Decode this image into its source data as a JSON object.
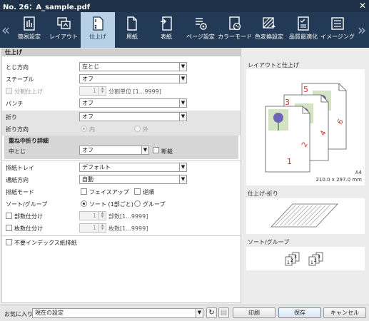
{
  "window": {
    "title": "No. 26：A_sample.pdf",
    "close_label": "✕"
  },
  "tabs": [
    {
      "label": "簡易設定",
      "icon": "simple-settings-icon"
    },
    {
      "label": "レイアウト",
      "icon": "layout-icon"
    },
    {
      "label": "仕上げ",
      "icon": "finishing-icon",
      "active": true
    },
    {
      "label": "用紙",
      "icon": "paper-icon"
    },
    {
      "label": "表紙",
      "icon": "cover-icon"
    },
    {
      "label": "ページ設定",
      "icon": "page-settings-icon"
    },
    {
      "label": "カラーモード",
      "icon": "color-mode-icon"
    },
    {
      "label": "色変換設定",
      "icon": "color-conversion-icon"
    },
    {
      "label": "品質最適化",
      "icon": "quality-icon"
    },
    {
      "label": "イメージング",
      "icon": "imaging-icon"
    }
  ],
  "finishing": {
    "section_title": "仕上げ",
    "binding_direction": {
      "label": "とじ方向",
      "value": "左とじ"
    },
    "staple": {
      "label": "ステープル",
      "value": "オフ"
    },
    "separate": {
      "label": "分割仕上げ",
      "value": "1",
      "unit": "分割単位 [1...9999]"
    },
    "punch": {
      "label": "パンチ",
      "value": "オフ"
    },
    "fold": {
      "label": "折り",
      "value": "オフ"
    },
    "fold_direction": {
      "label": "折り方向",
      "option_in": "内",
      "option_out": "外"
    },
    "saddle_detail": {
      "title": "重ね中折り詳細",
      "label": "中とじ",
      "value": "オフ",
      "trim_label": "断裁"
    }
  },
  "output": {
    "tray": {
      "label": "排紙トレイ",
      "value": "デフォルト"
    },
    "feed_direction": {
      "label": "通紙方向",
      "value": "自動"
    },
    "mode": {
      "label": "排紙モード",
      "face_up": "フェイスアップ",
      "reverse": "逆順"
    },
    "sort_group": {
      "label": "ソート/グループ",
      "sort": "ソート (1部ごと)",
      "group": "グループ"
    },
    "copies_split": {
      "label": "部数仕分け",
      "value": "1",
      "unit": "部数[1...9999]"
    },
    "sheets_split": {
      "label": "枚数仕分け",
      "value": "1",
      "unit": "枚数[1...9999]"
    },
    "no_index": {
      "label": "不要インデックス紙排紙"
    }
  },
  "preview": {
    "layout_title": "レイアウトと仕上げ",
    "page_numbers": [
      "1",
      "2",
      "3",
      "4",
      "5",
      "6"
    ],
    "paper_size": "A4",
    "paper_dims": "210.0 x 297.0 mm",
    "fold_title": "仕上げ-折り",
    "sort_title": "ソート/グループ",
    "sort_digits": [
      "1",
      "2",
      "3",
      "1",
      "2",
      "3"
    ]
  },
  "footer": {
    "favorites_label": "お気に入り",
    "favorites_value": "現在の設定",
    "print_label": "印刷",
    "save_label": "保存",
    "cancel_label": "キャンセル"
  },
  "colors": {
    "titlebar": "#1e3146",
    "tabbar": "#223a55",
    "active_tab": "#b7d0e6",
    "page_number_red": "#d42a2a"
  }
}
